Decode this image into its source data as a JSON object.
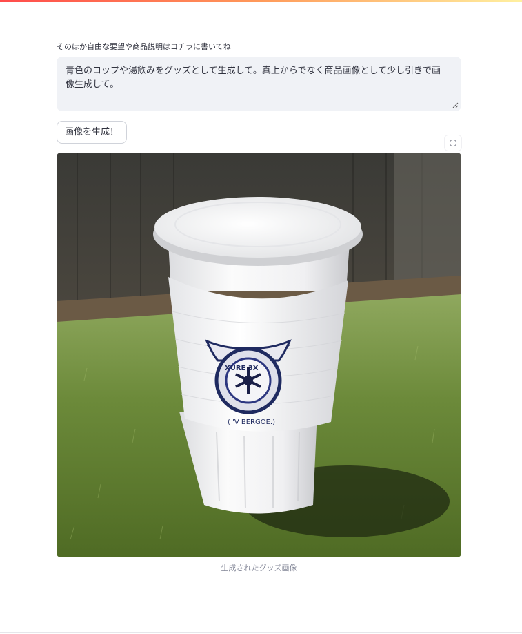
{
  "prompt_field": {
    "label": "そのほか自由な要望や商品説明はコチラに書いてね",
    "value_line1": "青色のコップや湯飲みをグッズとして生成して。真上からでなく商品画像として少し引きで画",
    "value_line2": "像生成して。"
  },
  "actions": {
    "generate_label": "画像を生成！"
  },
  "result": {
    "caption": "生成されたグッズ画像"
  },
  "icons": {
    "fullscreen": "fullscreen-icon",
    "resize": "resize-handle-icon"
  },
  "colors": {
    "accent": "#ff4b4b",
    "text": "#31333f",
    "input_bg": "#f0f2f6",
    "caption": "#808495"
  }
}
